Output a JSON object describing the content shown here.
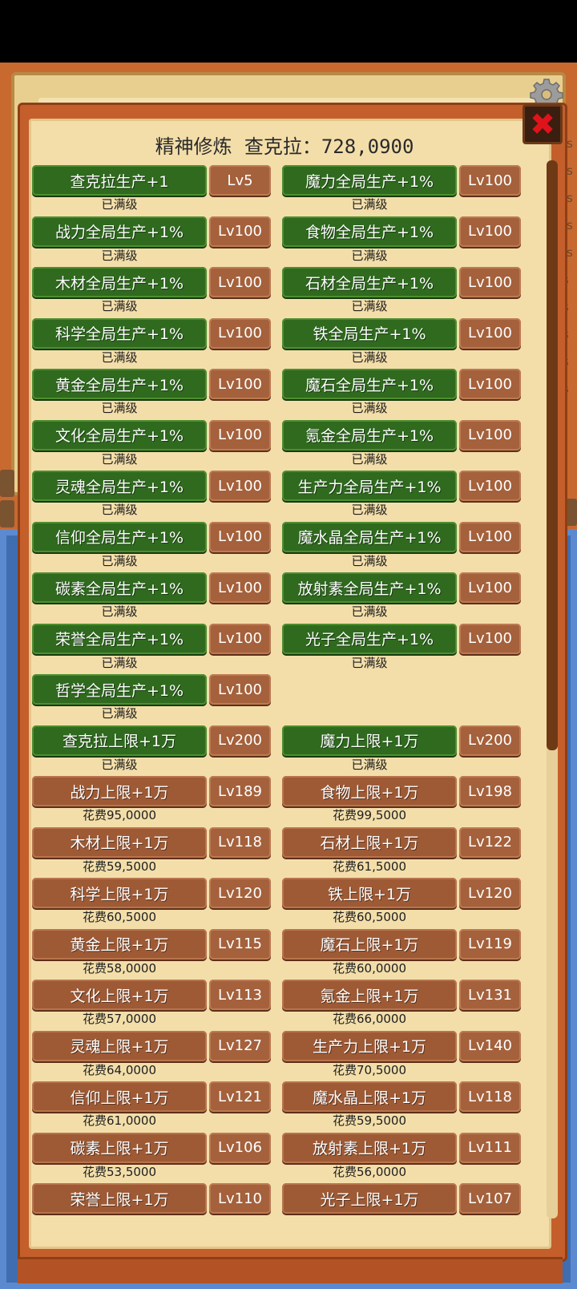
{
  "header": {
    "title_label": "精神修炼",
    "currency_label": "查克拉：",
    "currency_value": "728,0900"
  },
  "icons": {
    "settings": "gear-icon",
    "close": "close-x-icon",
    "close_color": "#e0131b"
  },
  "colors": {
    "maxed_button": "#2f6a1e",
    "upgrade_button": "#9e5a35",
    "level_button": "#a4613c",
    "parchment": "#f3deaa",
    "frame": "#c45f2c",
    "background_blue": "#3f6db0"
  },
  "side_labels": [
    "/s",
    "/s",
    "/s",
    "/s",
    "/s",
    "s",
    "s",
    "s",
    "s",
    "s"
  ],
  "upgrades": [
    {
      "name": "查克拉生产+1",
      "level": "Lv5",
      "status": "已满级",
      "maxed": true
    },
    {
      "name": "魔力全局生产+1%",
      "level": "Lv100",
      "status": "已满级",
      "maxed": true
    },
    {
      "name": "战力全局生产+1%",
      "level": "Lv100",
      "status": "已满级",
      "maxed": true
    },
    {
      "name": "食物全局生产+1%",
      "level": "Lv100",
      "status": "已满级",
      "maxed": true
    },
    {
      "name": "木材全局生产+1%",
      "level": "Lv100",
      "status": "已满级",
      "maxed": true
    },
    {
      "name": "石材全局生产+1%",
      "level": "Lv100",
      "status": "已满级",
      "maxed": true
    },
    {
      "name": "科学全局生产+1%",
      "level": "Lv100",
      "status": "已满级",
      "maxed": true
    },
    {
      "name": "铁全局生产+1%",
      "level": "Lv100",
      "status": "已满级",
      "maxed": true
    },
    {
      "name": "黄金全局生产+1%",
      "level": "Lv100",
      "status": "已满级",
      "maxed": true
    },
    {
      "name": "魔石全局生产+1%",
      "level": "Lv100",
      "status": "已满级",
      "maxed": true
    },
    {
      "name": "文化全局生产+1%",
      "level": "Lv100",
      "status": "已满级",
      "maxed": true
    },
    {
      "name": "氪金全局生产+1%",
      "level": "Lv100",
      "status": "已满级",
      "maxed": true
    },
    {
      "name": "灵魂全局生产+1%",
      "level": "Lv100",
      "status": "已满级",
      "maxed": true
    },
    {
      "name": "生产力全局生产+1%",
      "level": "Lv100",
      "status": "已满级",
      "maxed": true
    },
    {
      "name": "信仰全局生产+1%",
      "level": "Lv100",
      "status": "已满级",
      "maxed": true
    },
    {
      "name": "魔水晶全局生产+1%",
      "level": "Lv100",
      "status": "已满级",
      "maxed": true
    },
    {
      "name": "碳素全局生产+1%",
      "level": "Lv100",
      "status": "已满级",
      "maxed": true
    },
    {
      "name": "放射素全局生产+1%",
      "level": "Lv100",
      "status": "已满级",
      "maxed": true
    },
    {
      "name": "荣誉全局生产+1%",
      "level": "Lv100",
      "status": "已满级",
      "maxed": true
    },
    {
      "name": "光子全局生产+1%",
      "level": "Lv100",
      "status": "已满级",
      "maxed": true
    },
    {
      "name": "哲学全局生产+1%",
      "level": "Lv100",
      "status": "已满级",
      "maxed": true
    },
    null,
    {
      "name": "查克拉上限+1万",
      "level": "Lv200",
      "status": "已满级",
      "maxed": true
    },
    {
      "name": "魔力上限+1万",
      "level": "Lv200",
      "status": "已满级",
      "maxed": true
    },
    {
      "name": "战力上限+1万",
      "level": "Lv189",
      "status": "花费95,0000",
      "maxed": false
    },
    {
      "name": "食物上限+1万",
      "level": "Lv198",
      "status": "花费99,5000",
      "maxed": false
    },
    {
      "name": "木材上限+1万",
      "level": "Lv118",
      "status": "花费59,5000",
      "maxed": false
    },
    {
      "name": "石材上限+1万",
      "level": "Lv122",
      "status": "花费61,5000",
      "maxed": false
    },
    {
      "name": "科学上限+1万",
      "level": "Lv120",
      "status": "花费60,5000",
      "maxed": false
    },
    {
      "name": "铁上限+1万",
      "level": "Lv120",
      "status": "花费60,5000",
      "maxed": false
    },
    {
      "name": "黄金上限+1万",
      "level": "Lv115",
      "status": "花费58,0000",
      "maxed": false
    },
    {
      "name": "魔石上限+1万",
      "level": "Lv119",
      "status": "花费60,0000",
      "maxed": false
    },
    {
      "name": "文化上限+1万",
      "level": "Lv113",
      "status": "花费57,0000",
      "maxed": false
    },
    {
      "name": "氪金上限+1万",
      "level": "Lv131",
      "status": "花费66,0000",
      "maxed": false
    },
    {
      "name": "灵魂上限+1万",
      "level": "Lv127",
      "status": "花费64,0000",
      "maxed": false
    },
    {
      "name": "生产力上限+1万",
      "level": "Lv140",
      "status": "花费70,5000",
      "maxed": false
    },
    {
      "name": "信仰上限+1万",
      "level": "Lv121",
      "status": "花费61,0000",
      "maxed": false
    },
    {
      "name": "魔水晶上限+1万",
      "level": "Lv118",
      "status": "花费59,5000",
      "maxed": false
    },
    {
      "name": "碳素上限+1万",
      "level": "Lv106",
      "status": "花费53,5000",
      "maxed": false
    },
    {
      "name": "放射素上限+1万",
      "level": "Lv111",
      "status": "花费56,0000",
      "maxed": false
    },
    {
      "name": "荣誉上限+1万",
      "level": "Lv110",
      "status": "",
      "maxed": false
    },
    {
      "name": "光子上限+1万",
      "level": "Lv107",
      "status": "",
      "maxed": false
    }
  ]
}
